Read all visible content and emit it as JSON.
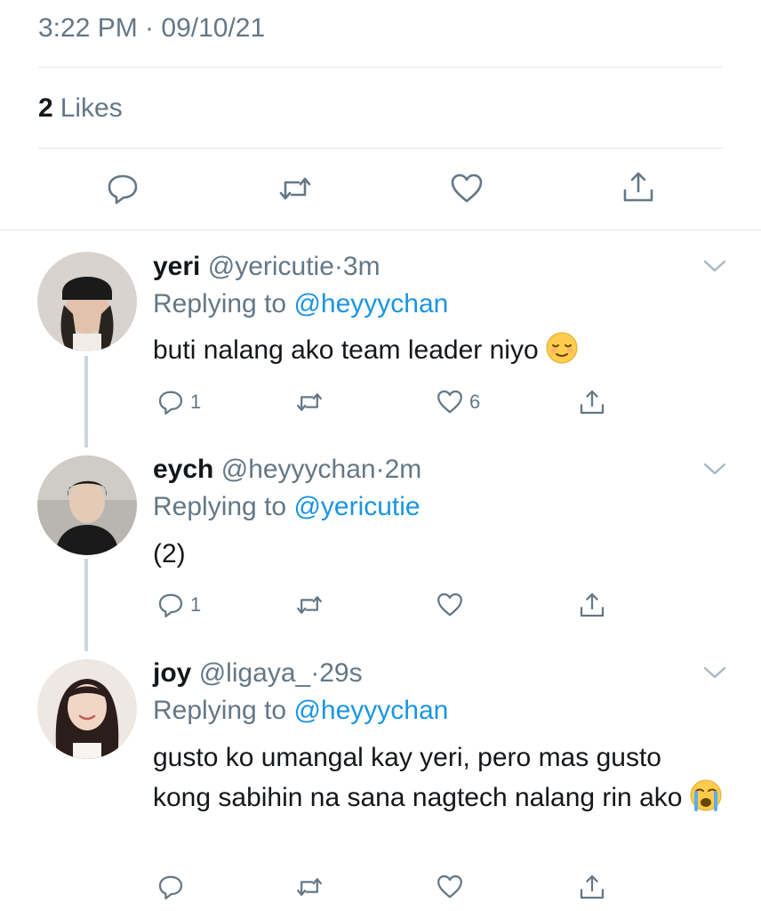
{
  "header": {
    "timestamp": "3:22 PM · 09/10/21",
    "likes_count": "2",
    "likes_label": "Likes"
  },
  "actions": {
    "reply_icon": "reply-icon",
    "retweet_icon": "retweet-icon",
    "like_icon": "heart-icon",
    "share_icon": "share-icon"
  },
  "colors": {
    "accent": "#1b95e0",
    "secondary_text": "#657786",
    "primary_text": "#14171a",
    "divider": "#e1e8ed"
  },
  "replies": [
    {
      "name": "yeri",
      "handle": "@yericutie",
      "dot": "·",
      "time": "3m",
      "replying_prefix": "Replying to",
      "replying_to": "@heyyychan",
      "text": "buti nalang ako team leader niyo",
      "emoji": "relieved-face-emoji",
      "reply_count": "1",
      "like_count": "6"
    },
    {
      "name": "eych",
      "handle": "@heyyychan",
      "dot": "·",
      "time": "2m",
      "replying_prefix": "Replying to",
      "replying_to": "@yericutie",
      "text": "(2)",
      "reply_count": "1",
      "like_count": ""
    },
    {
      "name": "joy",
      "handle": "@ligaya_",
      "dot": "·",
      "time": "29s",
      "replying_prefix": "Replying to",
      "replying_to": "@heyyychan",
      "text": "gusto ko umangal kay yeri, pero mas gusto kong sabihin na sana nagtech nalang rin ako",
      "emoji": "loudly-crying-face-emoji",
      "reply_count": "",
      "like_count": ""
    }
  ]
}
